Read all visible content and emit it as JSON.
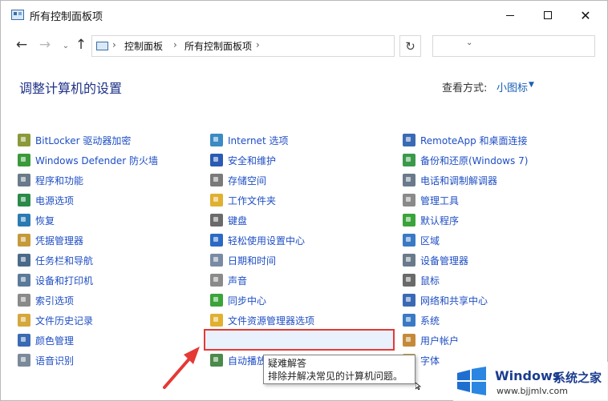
{
  "window": {
    "title": "所有控制面板项"
  },
  "address": {
    "crumbs": [
      "控制面板",
      "所有控制面板项"
    ],
    "sep": "›"
  },
  "heading": "调整计算机的设置",
  "view": {
    "label": "查看方式:",
    "value": "小图标"
  },
  "columns": [
    {
      "items": [
        {
          "label": "BitLocker 驱动器加密",
          "icon": "bitlocker-icon",
          "color": "#8a9a3a"
        },
        {
          "label": "Windows Defender 防火墙",
          "icon": "firewall-icon",
          "color": "#3a9a3a"
        },
        {
          "label": "程序和功能",
          "icon": "programs-icon",
          "color": "#6a7a8a"
        },
        {
          "label": "电源选项",
          "icon": "power-icon",
          "color": "#2a8a4a"
        },
        {
          "label": "恢复",
          "icon": "recovery-icon",
          "color": "#2a7ab4"
        },
        {
          "label": "凭据管理器",
          "icon": "credential-icon",
          "color": "#c49a3a"
        },
        {
          "label": "任务栏和导航",
          "icon": "taskbar-icon",
          "color": "#4a6a8a"
        },
        {
          "label": "设备和打印机",
          "icon": "printer-icon",
          "color": "#5a7a9a"
        },
        {
          "label": "索引选项",
          "icon": "index-icon",
          "color": "#8a8a8a"
        },
        {
          "label": "文件历史记录",
          "icon": "file-history-icon",
          "color": "#d4a83a"
        },
        {
          "label": "颜色管理",
          "icon": "color-management-icon",
          "color": "#3a6ab4"
        },
        {
          "label": "语音识别",
          "icon": "microphone-icon",
          "color": "#7a8a9a"
        }
      ]
    },
    {
      "items": [
        {
          "label": "Internet 选项",
          "icon": "internet-icon",
          "color": "#3a8ac4"
        },
        {
          "label": "安全和维护",
          "icon": "flag-icon",
          "color": "#2a5ab4"
        },
        {
          "label": "存储空间",
          "icon": "storage-icon",
          "color": "#7a7a7a"
        },
        {
          "label": "工作文件夹",
          "icon": "work-folder-icon",
          "color": "#e0b030"
        },
        {
          "label": "键盘",
          "icon": "keyboard-icon",
          "color": "#6a6a6a"
        },
        {
          "label": "轻松使用设置中心",
          "icon": "ease-of-access-icon",
          "color": "#2a6ac4"
        },
        {
          "label": "日期和时间",
          "icon": "clock-icon",
          "color": "#7a8aa4"
        },
        {
          "label": "声音",
          "icon": "speaker-icon",
          "color": "#8a8a8a"
        },
        {
          "label": "同步中心",
          "icon": "sync-icon",
          "color": "#3aa43a"
        },
        {
          "label": "文件资源管理器选项",
          "icon": "folder-options-icon",
          "color": "#e0b030"
        },
        {
          "label": "疑难解答",
          "icon": "troubleshoot-icon",
          "color": "#3a5aa4"
        },
        {
          "label": "自动播放",
          "icon": "autoplay-icon",
          "color": "#4a8a4a"
        }
      ]
    },
    {
      "items": [
        {
          "label": "RemoteApp 和桌面连接",
          "icon": "remoteapp-icon",
          "color": "#3a6ab4"
        },
        {
          "label": "备份和还原(Windows 7)",
          "icon": "backup-icon",
          "color": "#3a9a4a"
        },
        {
          "label": "电话和调制解调器",
          "icon": "phone-icon",
          "color": "#6a7a8a"
        },
        {
          "label": "管理工具",
          "icon": "admin-tools-icon",
          "color": "#8a8a8a"
        },
        {
          "label": "默认程序",
          "icon": "default-programs-icon",
          "color": "#3aa43a"
        },
        {
          "label": "区域",
          "icon": "region-icon",
          "color": "#3a7ac4"
        },
        {
          "label": "设备管理器",
          "icon": "device-manager-icon",
          "color": "#6a7a8a"
        },
        {
          "label": "鼠标",
          "icon": "mouse-icon",
          "color": "#6a6a6a"
        },
        {
          "label": "网络和共享中心",
          "icon": "network-icon",
          "color": "#3a6ab4"
        },
        {
          "label": "系统",
          "icon": "system-icon",
          "color": "#3a7ac4"
        },
        {
          "label": "用户帐户",
          "icon": "users-icon",
          "color": "#c48a3a"
        },
        {
          "label": "字体",
          "icon": "fonts-icon",
          "color": "#d4a83a"
        }
      ]
    }
  ],
  "tooltip": {
    "title": "疑难解答",
    "desc": "排除并解决常见的计算机问题。"
  },
  "watermark": {
    "brand1": "Windows",
    "brand2": "系统之家",
    "url": "www.bjjmlv.com"
  },
  "colors": {
    "link": "#1e4ec4",
    "heading": "#1e3287",
    "highlight": "#e53935"
  }
}
